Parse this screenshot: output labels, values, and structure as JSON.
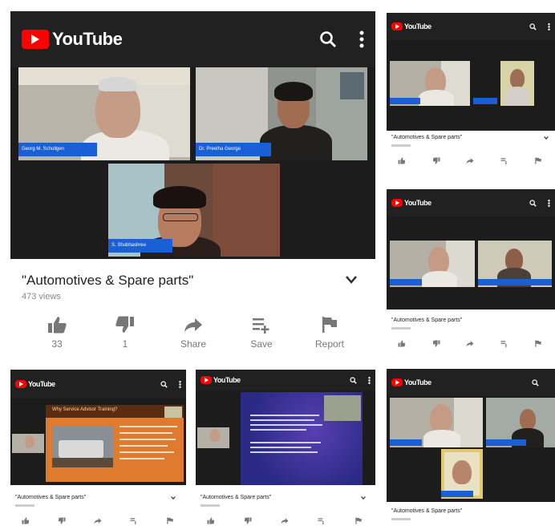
{
  "app": {
    "name": "YouTube"
  },
  "main": {
    "participants": [
      "Georg M. Schullgen",
      "Dr. Preetha George",
      "S. Shubhashree"
    ],
    "video_title": "\"Automotives & Spare parts\"",
    "views": "473 views",
    "actions": [
      {
        "label": "33",
        "icon": "thumbs-up-icon"
      },
      {
        "label": "1",
        "icon": "thumbs-down-icon"
      },
      {
        "label": "Share",
        "icon": "share-icon"
      },
      {
        "label": "Save",
        "icon": "playlist-add-icon"
      },
      {
        "label": "Report",
        "icon": "flag-icon"
      }
    ]
  },
  "thumbs": {
    "title": "\"Automotives & Spare parts\"",
    "slide_heading": "Why Service Advisor Training?"
  },
  "colors": {
    "brand": "#ff0000",
    "bar": "#212121",
    "name_tag": "#1a5fd6"
  }
}
